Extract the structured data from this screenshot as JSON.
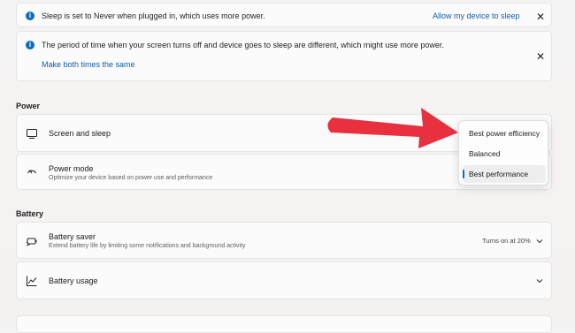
{
  "banners": [
    {
      "icon": "info-icon",
      "message": "Sleep is set to Never when plugged in, which uses more power.",
      "action": "Allow my device to sleep",
      "close": "✕"
    },
    {
      "icon": "info-icon",
      "message": "The period of time when your screen turns off and device goes to sleep are different, which might use more power.",
      "action": "Make both times the same",
      "close": "✕"
    }
  ],
  "power": {
    "heading": "Power",
    "screen_sleep": {
      "title": "Screen and sleep",
      "icon": "screen-sleep-icon"
    },
    "power_mode": {
      "title": "Power mode",
      "subtitle": "Optimize your device based on power use and performance",
      "icon": "power-mode-icon"
    }
  },
  "dropdown": {
    "options": [
      "Best power efficiency",
      "Balanced",
      "Best performance"
    ],
    "selected": "Best performance"
  },
  "battery": {
    "heading": "Battery",
    "saver": {
      "title": "Battery saver",
      "subtitle": "Extend battery life by limiting some notifications and background activity",
      "value": "Turns on at 20%",
      "icon": "battery-saver-icon"
    },
    "usage": {
      "title": "Battery usage",
      "icon": "battery-usage-icon"
    }
  },
  "colors": {
    "accent": "#0f6cbd",
    "annotation_arrow": "#e8303e"
  }
}
